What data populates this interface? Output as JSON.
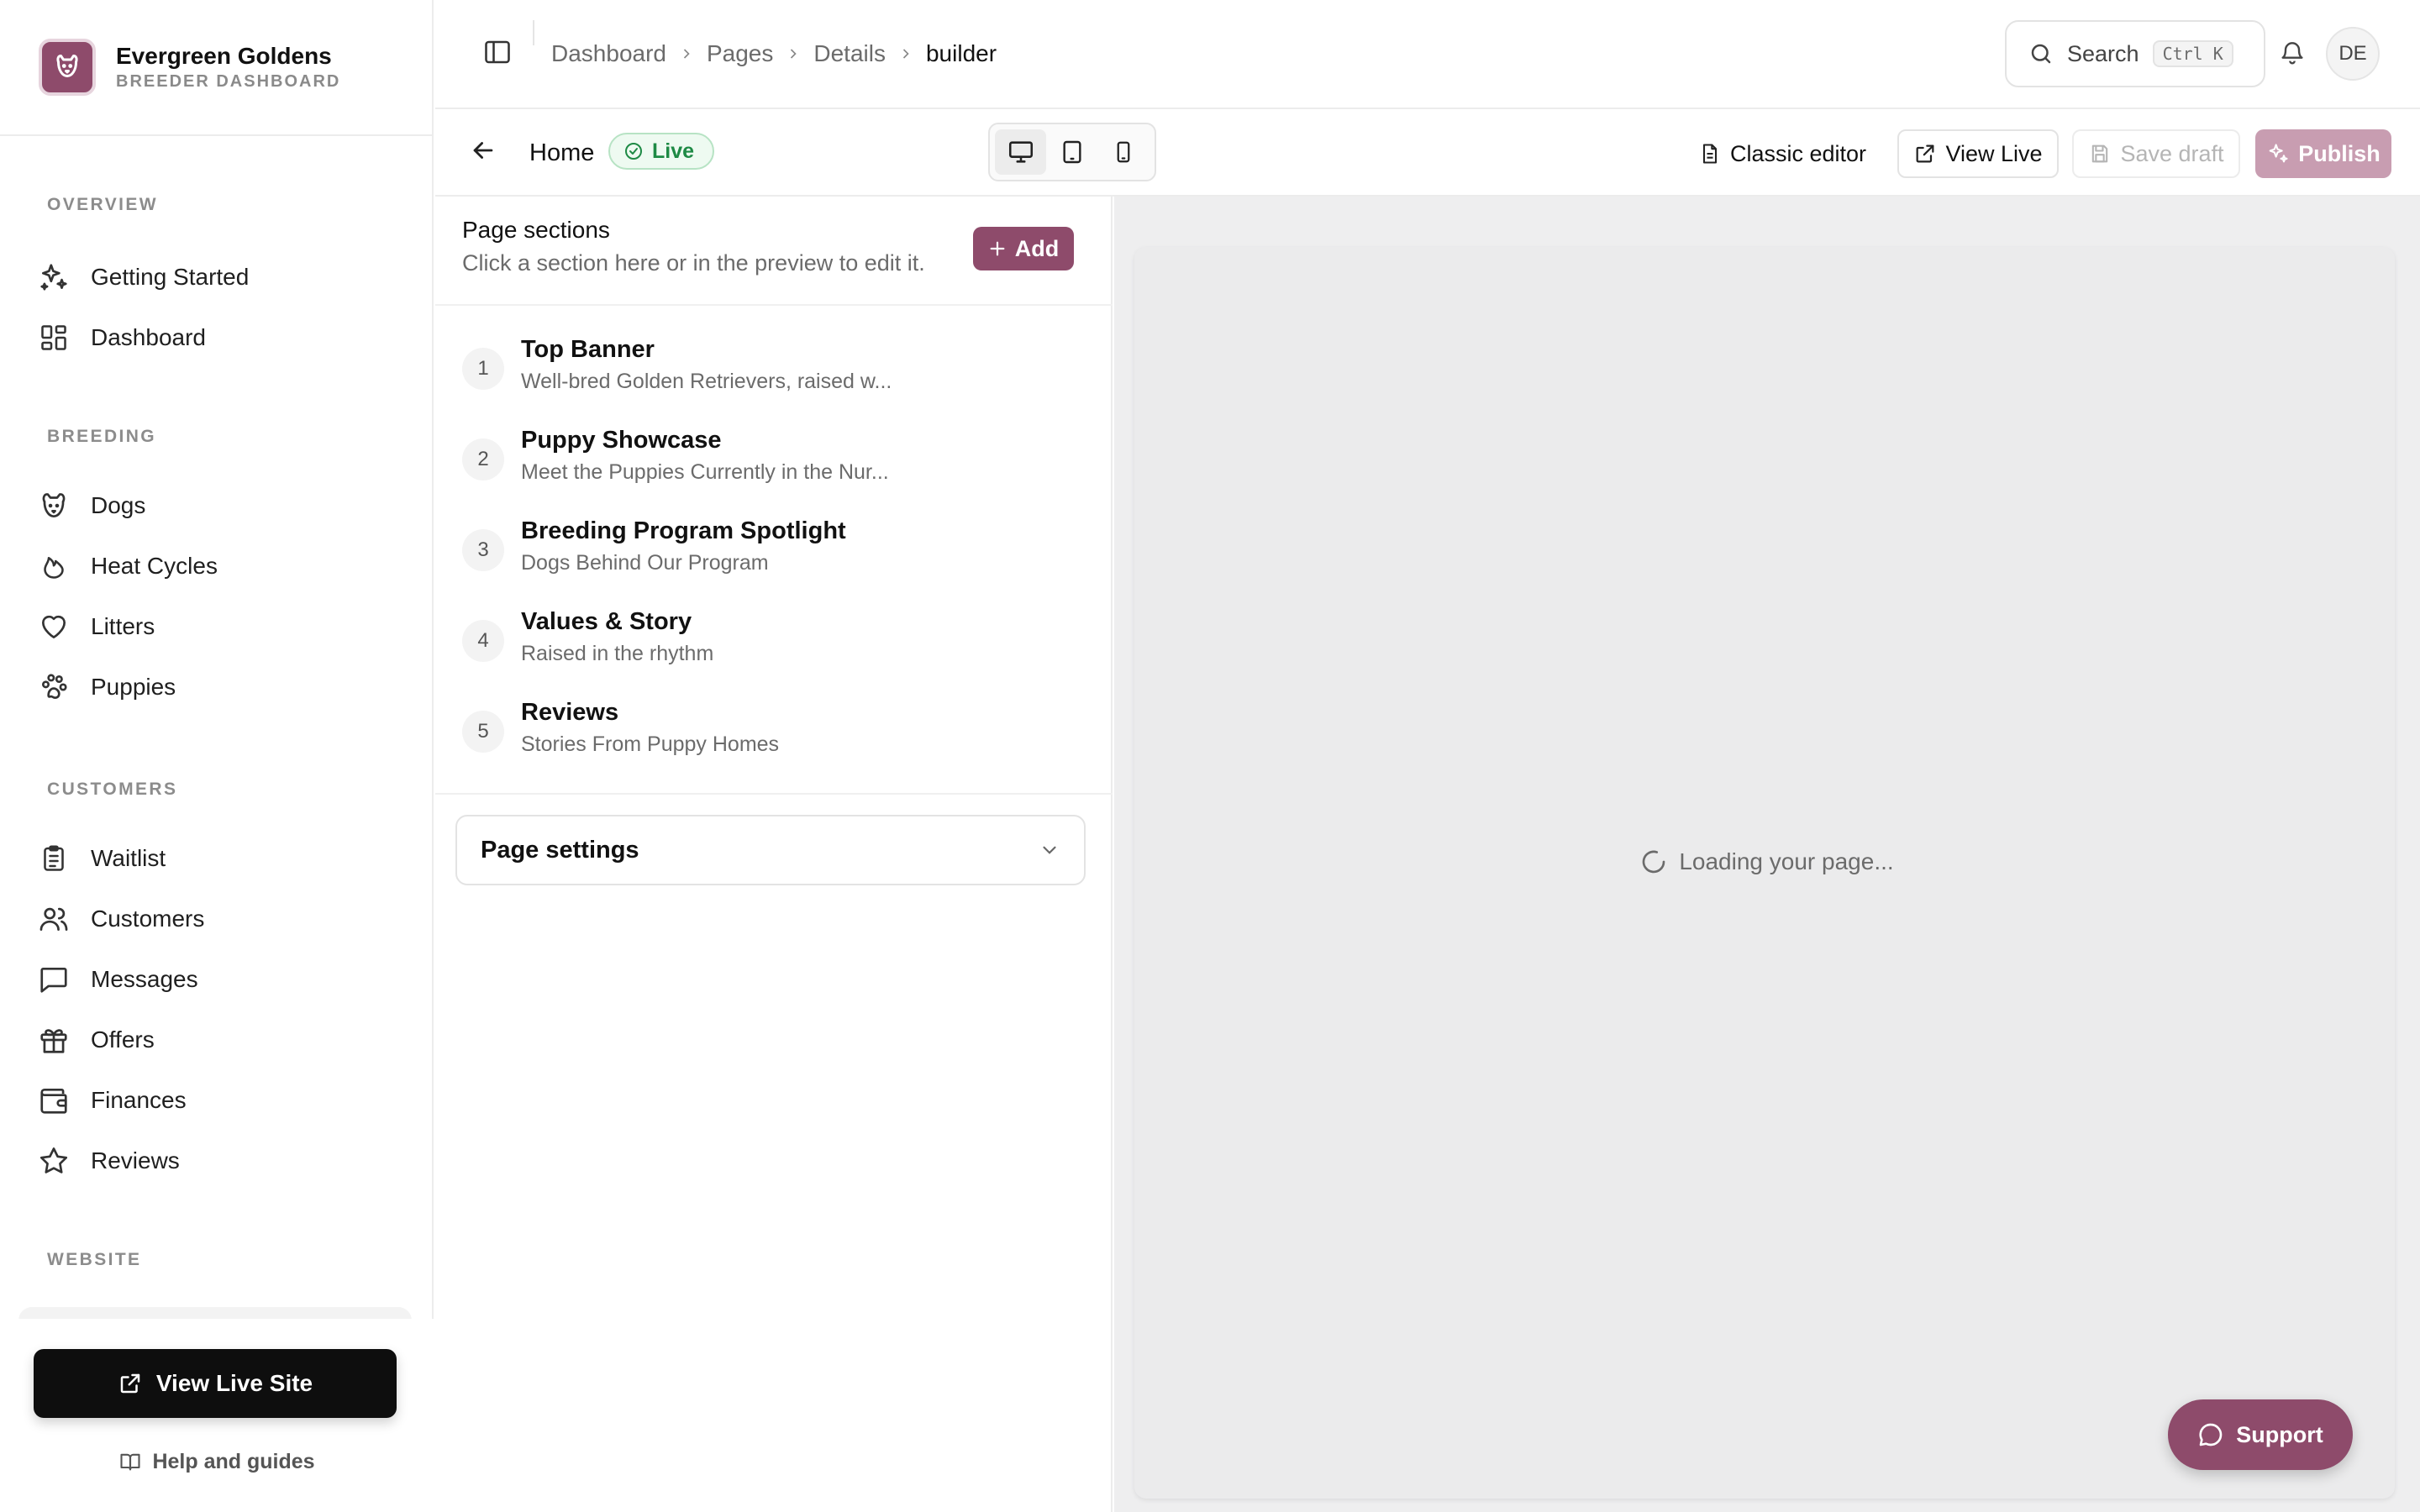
{
  "brand": {
    "name": "Evergreen Goldens",
    "subtitle": "BREEDER DASHBOARD",
    "accent": "#8e4b6b"
  },
  "sidebar": {
    "sections": [
      {
        "title": "OVERVIEW",
        "items": [
          {
            "label": "Getting Started",
            "icon": "sparkles-icon"
          },
          {
            "label": "Dashboard",
            "icon": "grid-icon"
          }
        ]
      },
      {
        "title": "BREEDING",
        "items": [
          {
            "label": "Dogs",
            "icon": "dog-icon"
          },
          {
            "label": "Heat Cycles",
            "icon": "flame-icon"
          },
          {
            "label": "Litters",
            "icon": "heart-icon"
          },
          {
            "label": "Puppies",
            "icon": "paw-icon"
          }
        ]
      },
      {
        "title": "CUSTOMERS",
        "items": [
          {
            "label": "Waitlist",
            "icon": "clipboard-icon"
          },
          {
            "label": "Customers",
            "icon": "users-icon"
          },
          {
            "label": "Messages",
            "icon": "message-icon"
          },
          {
            "label": "Offers",
            "icon": "gift-icon"
          },
          {
            "label": "Finances",
            "icon": "wallet-icon"
          },
          {
            "label": "Reviews",
            "icon": "star-icon"
          }
        ]
      },
      {
        "title": "WEBSITE",
        "items": []
      }
    ],
    "view_live_site": "View Live Site",
    "help": "Help and guides"
  },
  "topbar": {
    "breadcrumb": [
      "Dashboard",
      "Pages",
      "Details",
      "builder"
    ],
    "search_label": "Search",
    "search_shortcut": "Ctrl K",
    "avatar_initials": "DE"
  },
  "editor": {
    "page_name": "Home",
    "status": "Live",
    "status_color": "#1e8a45",
    "classic_editor": "Classic editor",
    "view_live": "View Live",
    "save_draft": "Save draft",
    "publish": "Publish"
  },
  "panel": {
    "title": "Page sections",
    "subtitle": "Click a section here or in the preview to edit it.",
    "add_label": "Add",
    "sections": [
      {
        "num": "1",
        "title": "Top Banner",
        "desc": "Well-bred Golden Retrievers, raised w..."
      },
      {
        "num": "2",
        "title": "Puppy Showcase",
        "desc": "Meet the Puppies Currently in the Nur..."
      },
      {
        "num": "3",
        "title": "Breeding Program Spotlight",
        "desc": "Dogs Behind Our Program"
      },
      {
        "num": "4",
        "title": "Values & Story",
        "desc": "Raised in the rhythm"
      },
      {
        "num": "5",
        "title": "Reviews",
        "desc": "Stories From Puppy Homes"
      }
    ],
    "settings_label": "Page settings"
  },
  "preview": {
    "loading": "Loading your page..."
  },
  "support": {
    "label": "Support"
  }
}
